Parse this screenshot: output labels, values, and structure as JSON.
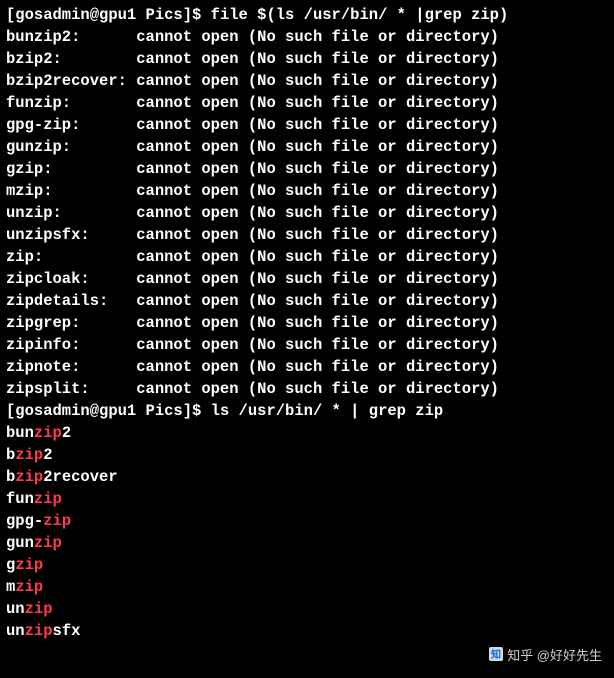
{
  "prompt1": {
    "bracket_open": "[",
    "userhost": "gosadmin@gpu1 Pics",
    "bracket_close": "]$ ",
    "command": "file $(ls /usr/bin/ * |grep zip)"
  },
  "file_output": [
    {
      "name": "bunzip2:",
      "pad": "      ",
      "msg": "cannot open (No such file or directory)"
    },
    {
      "name": "bzip2:",
      "pad": "        ",
      "msg": "cannot open (No such file or directory)"
    },
    {
      "name": "bzip2recover:",
      "pad": " ",
      "msg": "cannot open (No such file or directory)"
    },
    {
      "name": "funzip:",
      "pad": "       ",
      "msg": "cannot open (No such file or directory)"
    },
    {
      "name": "gpg-zip:",
      "pad": "      ",
      "msg": "cannot open (No such file or directory)"
    },
    {
      "name": "gunzip:",
      "pad": "       ",
      "msg": "cannot open (No such file or directory)"
    },
    {
      "name": "gzip:",
      "pad": "         ",
      "msg": "cannot open (No such file or directory)"
    },
    {
      "name": "mzip:",
      "pad": "         ",
      "msg": "cannot open (No such file or directory)"
    },
    {
      "name": "unzip:",
      "pad": "        ",
      "msg": "cannot open (No such file or directory)"
    },
    {
      "name": "unzipsfx:",
      "pad": "     ",
      "msg": "cannot open (No such file or directory)"
    },
    {
      "name": "zip:",
      "pad": "          ",
      "msg": "cannot open (No such file or directory)"
    },
    {
      "name": "zipcloak:",
      "pad": "     ",
      "msg": "cannot open (No such file or directory)"
    },
    {
      "name": "zipdetails:",
      "pad": "   ",
      "msg": "cannot open (No such file or directory)"
    },
    {
      "name": "zipgrep:",
      "pad": "      ",
      "msg": "cannot open (No such file or directory)"
    },
    {
      "name": "zipinfo:",
      "pad": "      ",
      "msg": "cannot open (No such file or directory)"
    },
    {
      "name": "zipnote:",
      "pad": "      ",
      "msg": "cannot open (No such file or directory)"
    },
    {
      "name": "zipsplit:",
      "pad": "     ",
      "msg": "cannot open (No such file or directory)"
    }
  ],
  "prompt2": {
    "bracket_open": "[",
    "userhost": "gosadmin@gpu1 Pics",
    "bracket_close": "]$ ",
    "command": "ls /usr/bin/ * | grep zip"
  },
  "grep_output": [
    {
      "pre": "bun",
      "match": "zip",
      "post": "2"
    },
    {
      "pre": "b",
      "match": "zip",
      "post": "2"
    },
    {
      "pre": "b",
      "match": "zip",
      "post": "2recover"
    },
    {
      "pre": "fun",
      "match": "zip",
      "post": ""
    },
    {
      "pre": "gpg-",
      "match": "zip",
      "post": ""
    },
    {
      "pre": "gun",
      "match": "zip",
      "post": ""
    },
    {
      "pre": "g",
      "match": "zip",
      "post": ""
    },
    {
      "pre": "m",
      "match": "zip",
      "post": ""
    },
    {
      "pre": "un",
      "match": "zip",
      "post": ""
    },
    {
      "pre": "un",
      "match": "zip",
      "post": "sfx"
    }
  ],
  "watermark": {
    "text": "知乎 @好好先生"
  }
}
